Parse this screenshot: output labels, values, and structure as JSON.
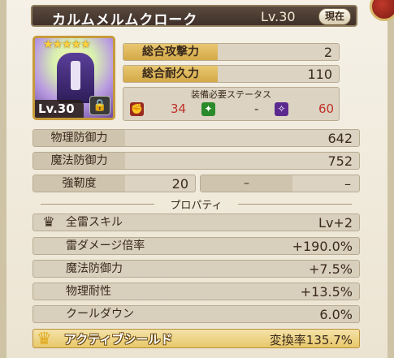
{
  "header": {
    "item_name": "カルムメルムクローク",
    "level": "Lv.30",
    "current_button": "現在"
  },
  "portrait": {
    "stars": "★★★★★",
    "level": "Lv.30"
  },
  "stats": {
    "total_attack": {
      "label": "総合攻撃力",
      "value": "2"
    },
    "total_endurance": {
      "label": "総合耐久力",
      "value": "110"
    }
  },
  "requirements": {
    "title": "装備必要ステータス",
    "items": [
      {
        "icon": "strength-icon",
        "value": "34",
        "color": "#c0312b"
      },
      {
        "icon": "dexterity-icon",
        "value": "-",
        "color": "#2b8a2b"
      },
      {
        "icon": "magic-icon",
        "value": "60",
        "color": "#c0312b"
      }
    ]
  },
  "defense": {
    "physical": {
      "label": "物理防御力",
      "value": "642"
    },
    "magical": {
      "label": "魔法防御力",
      "value": "752"
    },
    "toughness": {
      "label": "強靭度",
      "value": "20",
      "extra": "–",
      "extra_value": "–"
    }
  },
  "property": {
    "heading": "プロパティ",
    "rows": [
      {
        "label": "全雷スキル",
        "value": "Lv+2",
        "icon": "silver-crown-icon"
      },
      {
        "label": "雷ダメージ倍率",
        "value": "+190.0%"
      },
      {
        "label": "魔法防御力",
        "value": "+7.5%"
      },
      {
        "label": "物理耐性",
        "value": "+13.5%"
      },
      {
        "label": "クールダウン",
        "value": "6.0%"
      }
    ],
    "active": {
      "label": "アクティブシールド",
      "value": "変換率135.7%",
      "icon": "gold-crown-icon"
    }
  }
}
